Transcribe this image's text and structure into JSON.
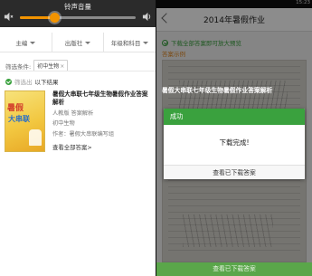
{
  "left": {
    "volume": {
      "title": "铃声音量",
      "level_fraction": 0.3,
      "colors": {
        "accent": "#f29300",
        "track": "#8a8a8a",
        "bar_bg": "#2b2b2b"
      }
    },
    "filters": [
      {
        "label": "主编"
      },
      {
        "label": "出版社"
      },
      {
        "label": "年级和科目"
      }
    ],
    "condition": {
      "label": "筛选条件:",
      "chip": "初中生物",
      "chip_close": "×"
    },
    "results": {
      "prefix": "筛选出",
      "text": "以下结果"
    },
    "book": {
      "title": "暑假大串联七年级生物暑假作业答案解析",
      "edition": "人教版 答案解析",
      "grade": "初中生物",
      "author": "作者：暑假大串联编写组",
      "more": "查看全部答案>",
      "cover_text_1": "暑假",
      "cover_text_2": "大串联"
    }
  },
  "right": {
    "clock": "15:23",
    "page_title": "2014年暑假作业",
    "download_tip": "下载全部答案即可放大预览",
    "answer_example": "答案示例",
    "book_title": "暑假大串联七年级生物暑假作业答案解析",
    "dialog": {
      "title": "成功",
      "message": "下载完成!",
      "button": "查看已下载答案"
    },
    "bottom_button": "查看已下载答案",
    "colors": {
      "green": "#3aa13e",
      "orange": "#e0851f"
    }
  }
}
